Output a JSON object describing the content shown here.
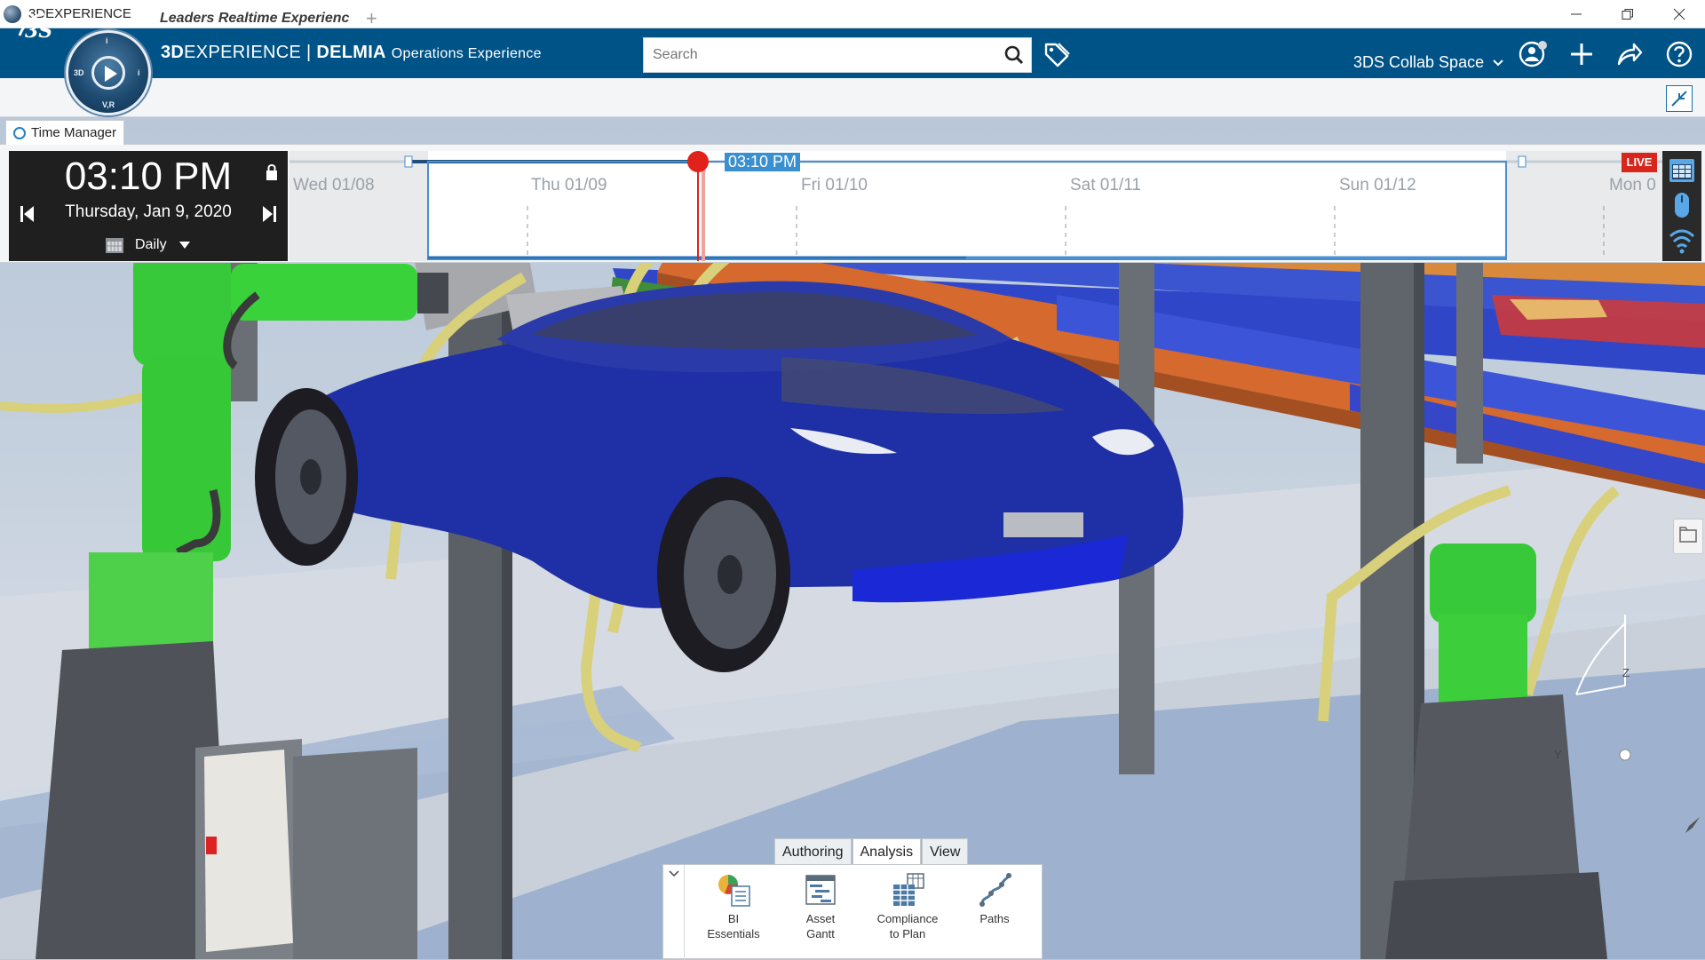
{
  "window": {
    "title": "3DEXPERIENCE",
    "controls": [
      "minimize-icon",
      "restore-icon",
      "close-icon"
    ]
  },
  "header": {
    "brand_bold": "3D",
    "brand_rest": "EXPERIENCE",
    "brand_separator": " | ",
    "brand_app": "DELMIA",
    "brand_sub": "Operations Experience",
    "compass_labels": {
      "top": "i",
      "left": "3D",
      "right": "i",
      "bottom": "V,R"
    },
    "search_placeholder": "Search",
    "collab_space": "3DS Collab Space",
    "icons": [
      "tag-icon",
      "user-icon",
      "add-icon",
      "share-icon",
      "help-icon"
    ],
    "brand_color": "#005386"
  },
  "tabs": {
    "active": "Leaders Realtime Experienc",
    "add": "+"
  },
  "time_manager": {
    "tab_label": "Time Manager",
    "time": "03:10 PM",
    "date": "Thursday, Jan 9, 2020",
    "mode": "Daily",
    "now_label": "03:10 PM",
    "live": "LIVE",
    "days": [
      "Wed 01/08",
      "Thu 01/09",
      "Fri 01/10",
      "Sat 01/11",
      "Sun 01/12",
      "Mon 0"
    ],
    "now_color": "#e0221b",
    "live_color": "#d9261c"
  },
  "viewport": {
    "axis_labels": {
      "z": "Z",
      "y": "Y"
    }
  },
  "action_bar": {
    "tabs": [
      "Authoring",
      "Analysis",
      "View"
    ],
    "active_tab": "Analysis",
    "commands": [
      {
        "line1": "BI",
        "line2": "Essentials",
        "icon": "bi-essentials-icon"
      },
      {
        "line1": "Asset",
        "line2": "Gantt",
        "icon": "asset-gantt-icon"
      },
      {
        "line1": "Compliance",
        "line2": "to Plan",
        "icon": "compliance-icon"
      },
      {
        "line1": "Paths",
        "line2": "",
        "icon": "paths-icon"
      }
    ]
  }
}
